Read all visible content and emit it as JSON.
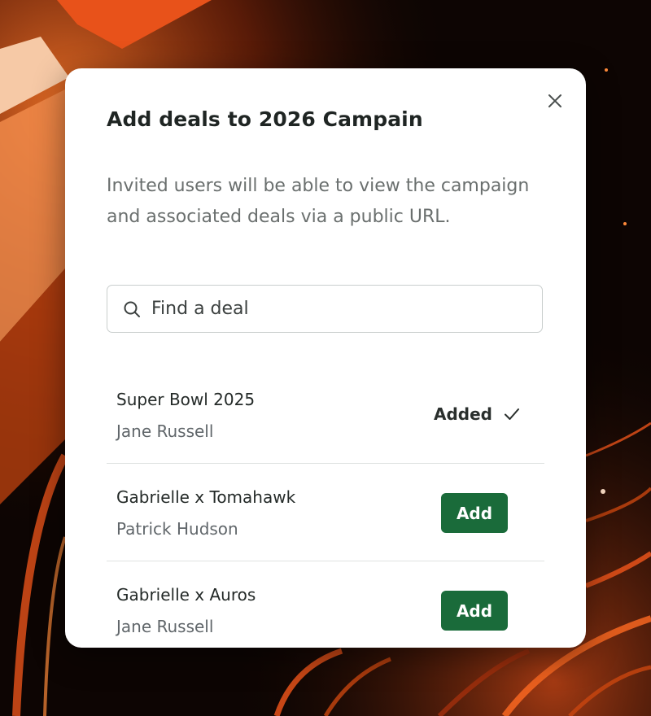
{
  "colors": {
    "accent": "#1a6b3a",
    "backdrop_dark": "#0d0503",
    "backdrop_orange": "#e8521a"
  },
  "modal": {
    "title": "Add deals to 2026 Campain",
    "close_icon": "close-icon",
    "description": "Invited users will be able to view the campaign and associated deals via a public URL.",
    "search": {
      "icon": "search-icon",
      "placeholder": "Find a deal",
      "value": ""
    },
    "deals": [
      {
        "name": "Super Bowl 2025",
        "owner": "Jane Russell",
        "status": "added",
        "status_label": "Added",
        "status_icon": "checkmark-icon"
      },
      {
        "name": "Gabrielle x Tomahawk",
        "owner": "Patrick Hudson",
        "status": "not_added",
        "action_label": "Add"
      },
      {
        "name": "Gabrielle x Auros",
        "owner": "Jane Russell",
        "status": "not_added",
        "action_label": "Add"
      }
    ]
  }
}
